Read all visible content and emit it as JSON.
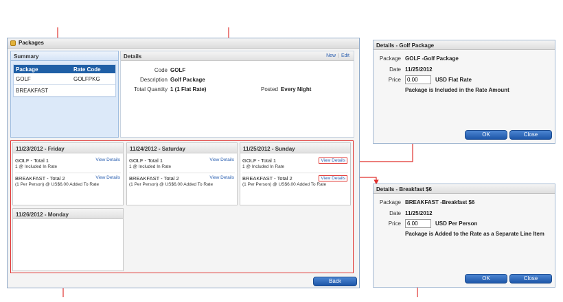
{
  "window": {
    "title": "Packages"
  },
  "summary": {
    "title": "Summary",
    "columns": [
      "Package",
      "Rate Code"
    ],
    "rows": [
      {
        "package": "GOLF",
        "rate_code": "GOLFPKG"
      },
      {
        "package": "BREAKFAST",
        "rate_code": ""
      }
    ]
  },
  "details": {
    "title": "Details",
    "new_link": "New",
    "edit_link": "Edit",
    "code_label": "Code",
    "code_value": "GOLF",
    "description_label": "Description",
    "description_value": "Golf Package",
    "total_qty_label": "Total Quantity",
    "total_qty_value": "1 (1 Flat Rate)",
    "posted_label": "Posted",
    "posted_value": "Every Night"
  },
  "days": [
    {
      "date": "11/23/2012 - Friday",
      "lines": [
        {
          "name": "GOLF - Total 1",
          "sub": "1 @ Included In Rate",
          "view": "View Details"
        },
        {
          "name": "BREAKFAST - Total 2",
          "sub": "(1 Per Person) @ US$6.00 Added To Rate",
          "view": "View Details"
        }
      ]
    },
    {
      "date": "11/24/2012 - Saturday",
      "lines": [
        {
          "name": "GOLF - Total 1",
          "sub": "1 @ Included In Rate",
          "view": "View Details"
        },
        {
          "name": "BREAKFAST - Total 2",
          "sub": "(1 Per Person) @ US$6.00 Added To Rate",
          "view": "View Details"
        }
      ]
    },
    {
      "date": "11/25/2012 - Sunday",
      "lines": [
        {
          "name": "GOLF - Total 1",
          "sub": "1 @ Included In Rate",
          "view": "View Details"
        },
        {
          "name": "BREAKFAST - Total 2",
          "sub": "(1 Per Person) @ US$6.00 Added To Rate",
          "view": "View Details"
        }
      ]
    },
    {
      "date": "11/26/2012 - Monday",
      "lines": []
    }
  ],
  "back_button": "Back",
  "golf_popup": {
    "title": "Details - Golf Package",
    "package_label": "Package",
    "package_value": "GOLF  -Golf Package",
    "date_label": "Date",
    "date_value": "11/25/2012",
    "price_label": "Price",
    "price_value": "0.00",
    "price_suffix": "USD Flat Rate",
    "note": "Package is Included in the Rate Amount",
    "ok": "OK",
    "close": "Close"
  },
  "breakfast_popup": {
    "title": "Details - Breakfast $6",
    "package_label": "Package",
    "package_value": "BREAKFAST  -Breakfast $6",
    "date_label": "Date",
    "date_value": "11/25/2012",
    "price_label": "Price",
    "price_value": "6.00",
    "price_suffix": "USD Per Person",
    "note": "Package is Added to the Rate as a Separate Line Item",
    "ok": "OK",
    "close": "Close"
  },
  "colors": {
    "annotation": "#e0312e",
    "button": "#1d56a8",
    "link": "#2a5fb0",
    "grid_header": "#1f5fa6"
  }
}
